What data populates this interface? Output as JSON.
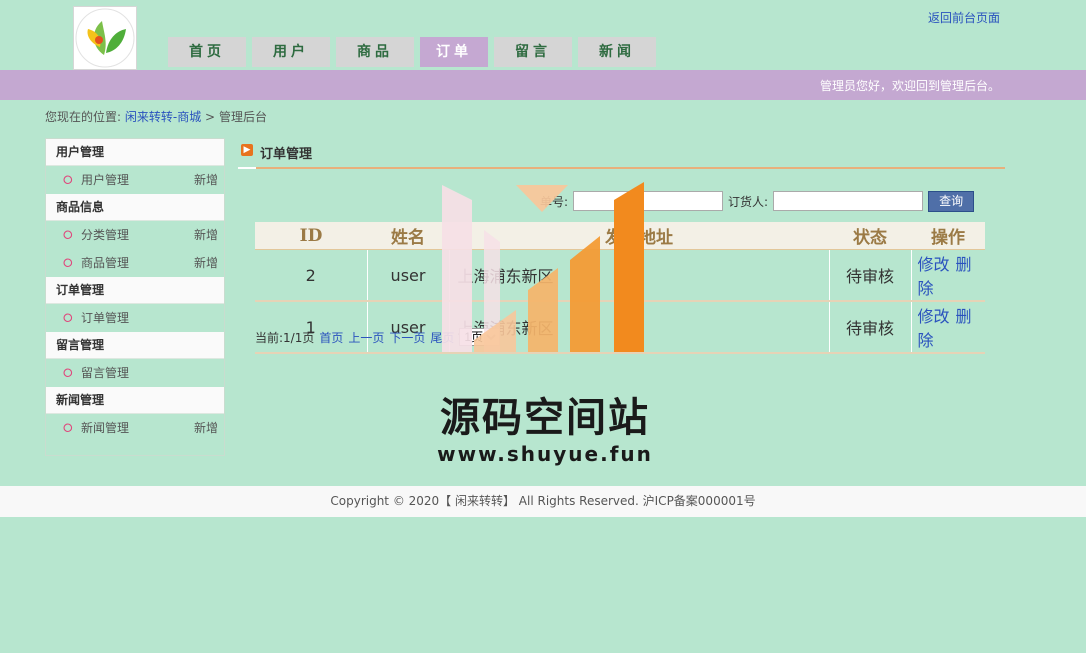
{
  "header": {
    "back_link": "返回前台页面",
    "welcome": "管理员您好，欢迎回到管理后台。",
    "nav": [
      {
        "label": "首页",
        "active": false
      },
      {
        "label": "用户",
        "active": false
      },
      {
        "label": "商品",
        "active": false
      },
      {
        "label": "订单",
        "active": true
      },
      {
        "label": "留言",
        "active": false
      },
      {
        "label": "新闻",
        "active": false
      }
    ]
  },
  "breadcrumb": {
    "prefix": "您现在的位置:",
    "site": "闲来转转-商城",
    "sep": ">",
    "current": "管理后台"
  },
  "sidebar": {
    "add_label": "新增",
    "groups": [
      {
        "title": "用户管理",
        "items": [
          {
            "label": "用户管理",
            "add": true
          }
        ]
      },
      {
        "title": "商品信息",
        "items": [
          {
            "label": "分类管理",
            "add": true
          },
          {
            "label": "商品管理",
            "add": true
          }
        ]
      },
      {
        "title": "订单管理",
        "items": [
          {
            "label": "订单管理",
            "add": false
          }
        ]
      },
      {
        "title": "留言管理",
        "items": [
          {
            "label": "留言管理",
            "add": false
          }
        ]
      },
      {
        "title": "新闻管理",
        "items": [
          {
            "label": "新闻管理",
            "add": true
          }
        ]
      }
    ]
  },
  "main": {
    "title": "订单管理",
    "search": {
      "order_no_label": "单号:",
      "order_no_value": "",
      "buyer_label": "订货人:",
      "buyer_value": "",
      "query_button": "查询"
    },
    "table": {
      "headers": [
        "ID",
        "姓名",
        "发货地址",
        "状态",
        "操作"
      ],
      "rows": [
        {
          "id": "2",
          "name": "user",
          "address": "上海浦东新区",
          "status": "待审核"
        },
        {
          "id": "1",
          "name": "user",
          "address": "上海浦东新区",
          "status": "待审核"
        }
      ],
      "edit_label": "修改",
      "delete_label": "删除"
    },
    "pager": {
      "status": "当前:1/1页",
      "first": "首页",
      "prev": "上一页",
      "next": "下一页",
      "last": "尾页",
      "selected_page": "1页"
    }
  },
  "footer": {
    "copyright": "Copyright © 2020【 闲来转转】 All Rights Reserved. 沪ICP备案000001号"
  },
  "watermark": {
    "title": "源码空间站",
    "url": "www.shuyue.fun"
  },
  "colors": {
    "background": "#b7e6cf",
    "accent_purple": "#c4a8d1",
    "link_blue": "#2a52be",
    "watermark_orange": "#f28a1e"
  }
}
